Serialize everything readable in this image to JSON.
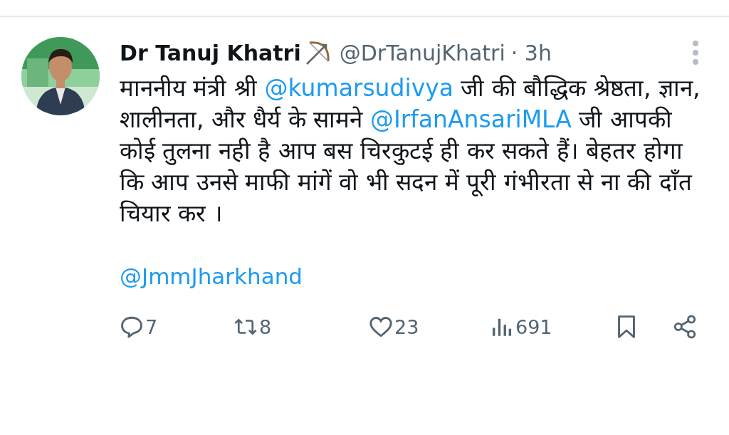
{
  "tweet": {
    "author": {
      "name": "Dr Tanuj Khatri",
      "handle": "@DrTanujKhatri",
      "time": "· 3h"
    },
    "body": [
      {
        "kind": "text",
        "text": "माननीय मंत्री श्री "
      },
      {
        "kind": "mention",
        "text": "@kumarsudivya"
      },
      {
        "kind": "text",
        "text": " जी की बौद्धिक श्रेष्ठता, ज्ञान, शालीनता, और धैर्य के सामने "
      },
      {
        "kind": "mention",
        "text": "@IrfanAnsariMLA"
      },
      {
        "kind": "text",
        "text": " जी आपकी कोई तुलना नही है आप बस चिरकुटई ही कर सकते हैं। बेहतर होगा कि आप उनसे माफी मांगें वो भी सदन में पूरी गंभीरता से ना की दाँत चियार कर ।"
      }
    ],
    "footer_mention": "@JmmJharkhand",
    "actions": [
      {
        "kind": "reply",
        "count": "7"
      },
      {
        "kind": "retweet",
        "count": "8"
      },
      {
        "kind": "like",
        "count": "23"
      },
      {
        "kind": "views",
        "count": "691"
      },
      {
        "kind": "bookmark"
      },
      {
        "kind": "share"
      }
    ]
  }
}
